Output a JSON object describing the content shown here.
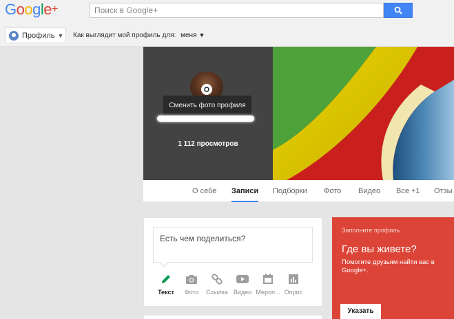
{
  "header": {
    "logo": {
      "letters": [
        "G",
        "o",
        "o",
        "g",
        "l",
        "e",
        " +"
      ],
      "colors": [
        "#4285f4",
        "#db4437",
        "#f4b400",
        "#4285f4",
        "#0f9d58",
        "#db4437",
        "#db4437"
      ]
    },
    "search": {
      "placeholder": "Поиск в Google+",
      "button_icon": "search-icon",
      "accent": "#4285f4"
    }
  },
  "subbar": {
    "profile_label": "Профиль",
    "view_as_label": "Как выглядит мой профиль для:",
    "view_as_value": "меня"
  },
  "cover": {
    "tooltip": "Сменить фото профиля",
    "views": "1 112 просмотров"
  },
  "tabs": [
    {
      "label": "О себе",
      "active": false
    },
    {
      "label": "Записи",
      "active": true
    },
    {
      "label": "Подборки",
      "active": false
    },
    {
      "label": "Фото",
      "active": false
    },
    {
      "label": "Видео",
      "active": false
    },
    {
      "label": "Все +1",
      "active": false
    },
    {
      "label": "Отзы",
      "active": false
    }
  ],
  "share": {
    "placeholder": "Есть чем поделиться?",
    "actions": [
      {
        "label": "Текст",
        "icon": "pencil-icon",
        "active": true,
        "color": "#0f9d58"
      },
      {
        "label": "Фото",
        "icon": "camera-icon",
        "active": false
      },
      {
        "label": "Ссылка",
        "icon": "link-icon",
        "active": false
      },
      {
        "label": "Видео",
        "icon": "video-icon",
        "active": false
      },
      {
        "label": "Мероп...",
        "icon": "event-icon",
        "active": false
      },
      {
        "label": "Опрос",
        "icon": "poll-icon",
        "active": false
      }
    ]
  },
  "promo": {
    "heading": "Заполните профиль",
    "question": "Где вы живете?",
    "text": "Помогите друзьям найти вас в Google+.",
    "button": "Указать",
    "color": "#db4437"
  }
}
